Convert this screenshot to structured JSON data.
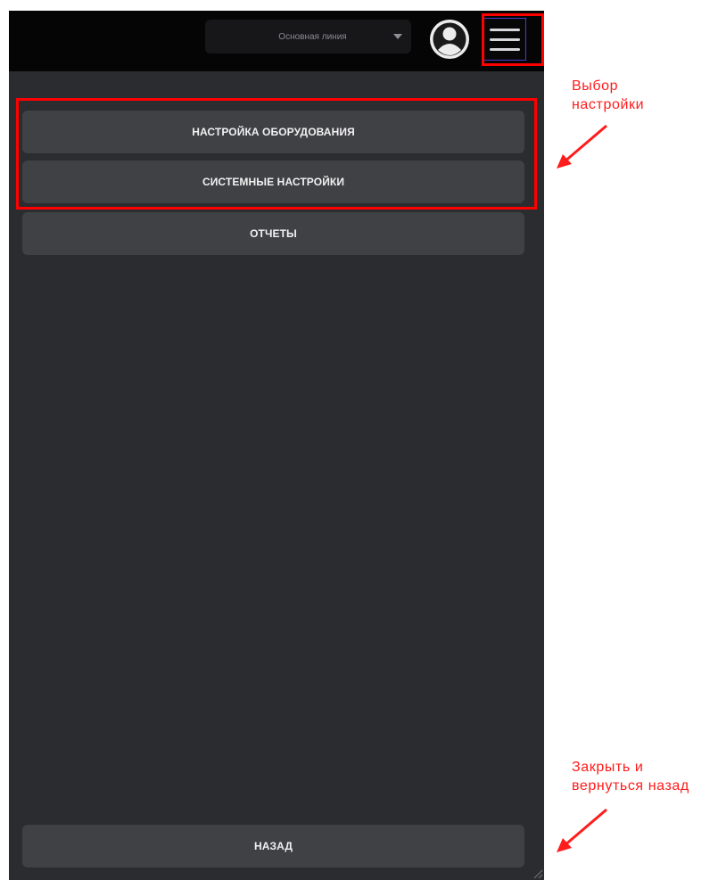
{
  "header": {
    "line_select": {
      "value": "Основная линия",
      "icon": "caret-down-icon"
    },
    "profile_icon": "user-circle-icon",
    "menu_icon": "hamburger-menu-icon"
  },
  "menu": {
    "items": [
      {
        "label": "НАСТРОЙКА ОБОРУДОВАНИЯ"
      },
      {
        "label": "СИСТЕМНЫЕ НАСТРОЙКИ"
      },
      {
        "label": "ОТЧЕТЫ"
      }
    ],
    "back_label": "НАЗАД"
  },
  "annotations": {
    "select_settings": "Выбор\nнастройки",
    "close_back": "Закрыть и\nвернуться назад"
  },
  "colors": {
    "panel_bg": "#2b2c2f",
    "topbar_bg": "#050505",
    "button_bg": "#404145",
    "highlight": "#ff0000",
    "annotation": "#ff1c1c"
  }
}
